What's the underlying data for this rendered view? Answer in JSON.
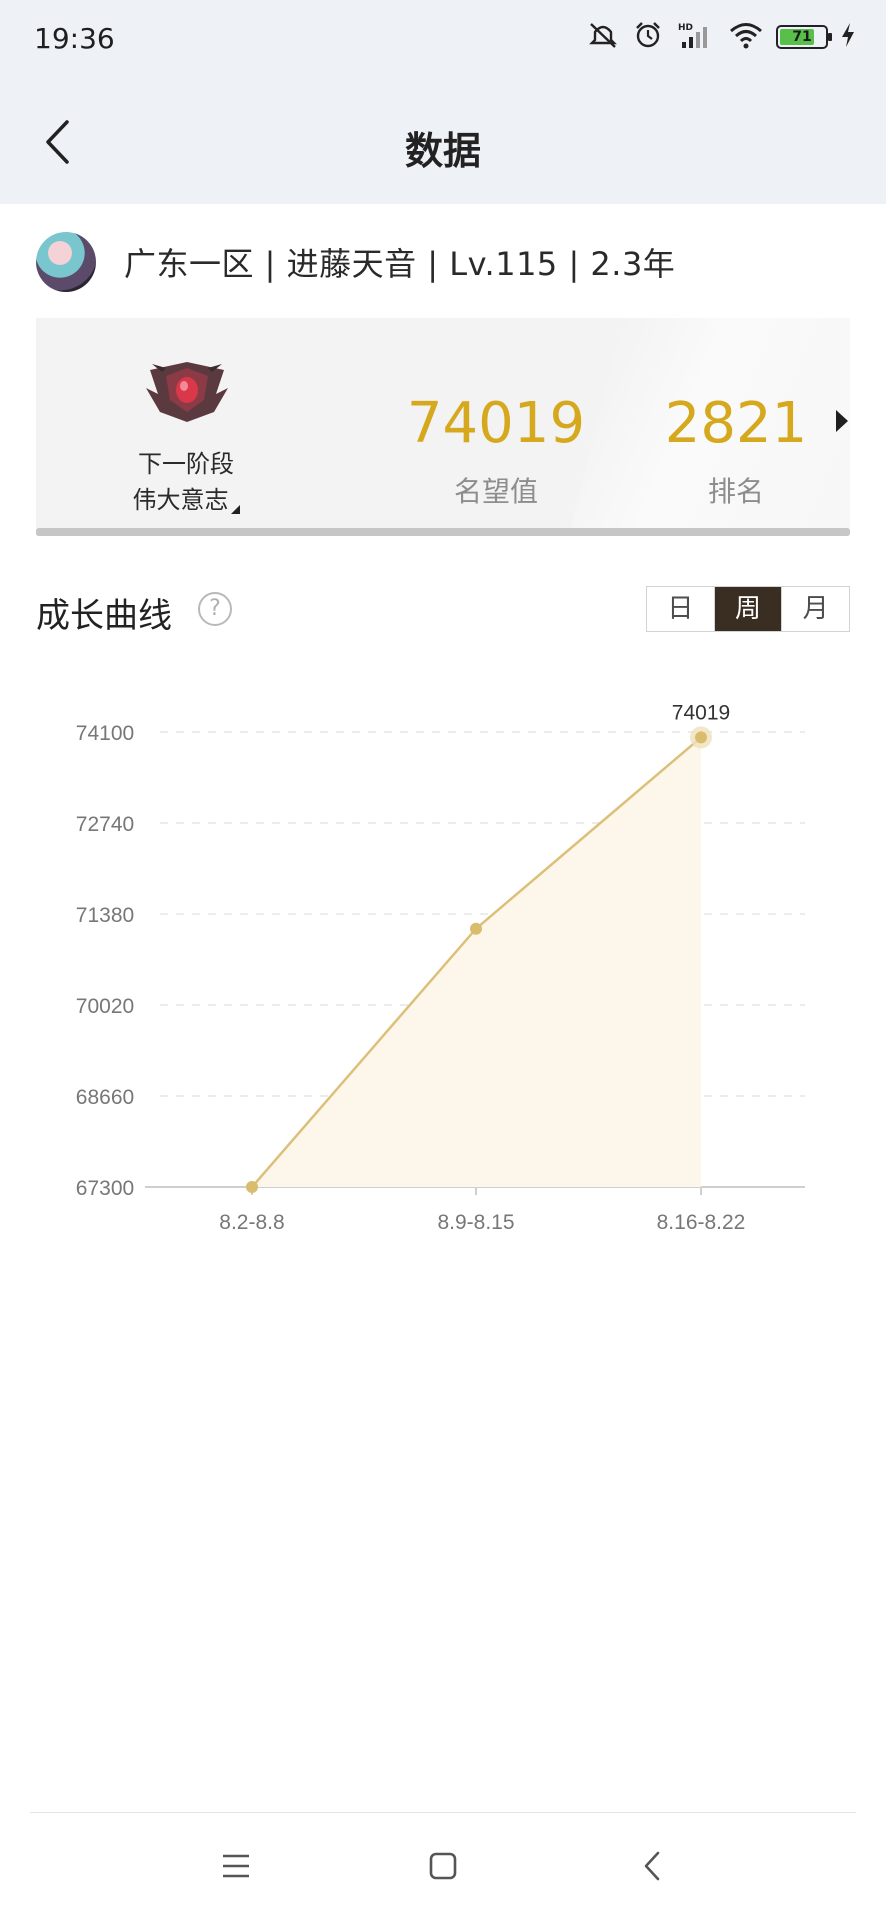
{
  "status_bar": {
    "time": "19:36",
    "battery_level": "71",
    "icons": [
      "mute-icon",
      "alarm-icon",
      "hd-signal-icon",
      "wifi-icon",
      "battery-icon",
      "charging-icon"
    ]
  },
  "header": {
    "title": "数据",
    "back_icon": "back-arrow-icon"
  },
  "profile": {
    "summary": "广东一区 | 进藤天音 | Lv.115 | 2.3年"
  },
  "rank_card": {
    "next_stage_label": "下一阶段",
    "next_stage_name": "伟大意志",
    "fame_value": "74019",
    "fame_label": "名望值",
    "rank_value": "2821",
    "rank_label": "排名"
  },
  "growth": {
    "title": "成长曲线",
    "help_icon": "?",
    "periods": [
      "日",
      "周",
      "月"
    ],
    "selected_period": "周"
  },
  "chart_data": {
    "type": "area",
    "x": [
      "8.2-8.8",
      "8.9-8.15",
      "8.16-8.22"
    ],
    "values": [
      67300,
      71160,
      74019
    ],
    "y_ticks": [
      "74100",
      "72740",
      "71380",
      "70020",
      "68660",
      "67300"
    ],
    "ylim": [
      67300,
      74100
    ],
    "last_point_label": "74019",
    "grid": true,
    "line_color": "#dcc07a",
    "fill_color": "#fdf6ea"
  },
  "system_nav": {
    "icons": [
      "menu-icon",
      "home-icon",
      "back-icon"
    ]
  }
}
